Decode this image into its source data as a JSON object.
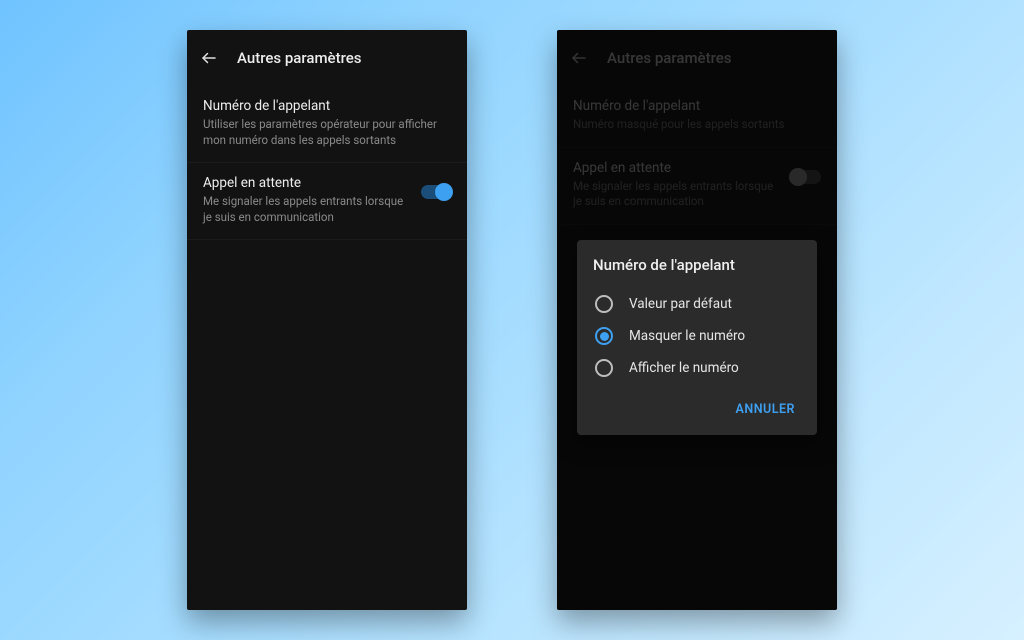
{
  "screen1": {
    "appbar": {
      "title": "Autres paramètres"
    },
    "callerId": {
      "title": "Numéro de l'appelant",
      "subtitle": "Utiliser les paramètres opérateur pour afficher mon numéro dans les appels sortants"
    },
    "callWaiting": {
      "title": "Appel en attente",
      "subtitle": "Me signaler les appels entrants lorsque je suis en communication",
      "enabled": true
    }
  },
  "screen2": {
    "appbar": {
      "title": "Autres paramètres"
    },
    "callerId": {
      "title": "Numéro de l'appelant",
      "subtitle": "Numéro masqué pour les appels sortants"
    },
    "callWaiting": {
      "title": "Appel en attente",
      "subtitle": "Me signaler les appels entrants lorsque je suis en communication",
      "enabled": false
    },
    "dialog": {
      "title": "Numéro de l'appelant",
      "options": [
        {
          "label": "Valeur par défaut",
          "selected": false
        },
        {
          "label": "Masquer le numéro",
          "selected": true
        },
        {
          "label": "Afficher le numéro",
          "selected": false
        }
      ],
      "cancel": "ANNULER"
    }
  },
  "colors": {
    "accent": "#3ea0f1",
    "surface": "#121212",
    "dialog": "#2b2b2b"
  }
}
